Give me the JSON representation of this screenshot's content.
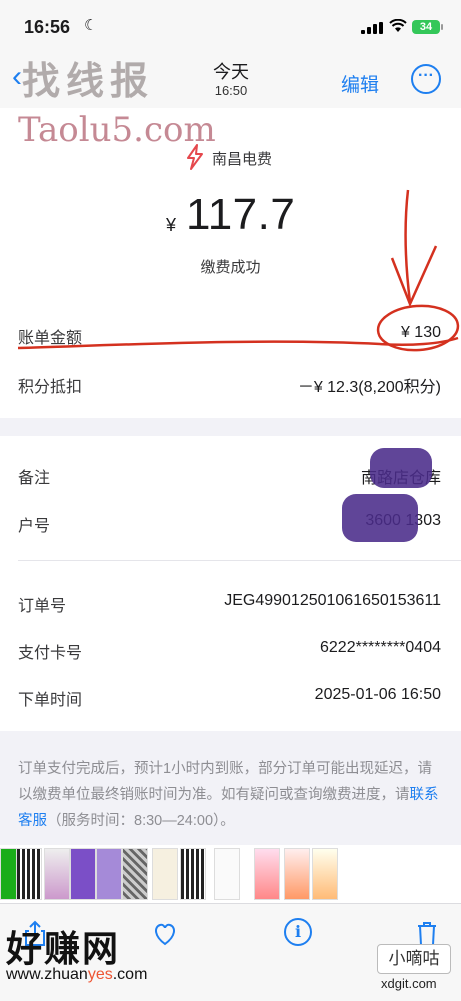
{
  "status_bar": {
    "time": "16:56",
    "battery": "34"
  },
  "nav": {
    "title": "今天",
    "subtitle": "16:50",
    "edit_label": "编辑",
    "more_label": "···"
  },
  "header": {
    "merchant": "南昌电费",
    "currency": "¥",
    "amount": "117.7",
    "status": "缴费成功"
  },
  "summary": [
    {
      "label": "账单金额",
      "value": "¥ 130"
    },
    {
      "label": "积分抵扣",
      "value": "－¥ 12.3(8,200积分)"
    }
  ],
  "details": [
    {
      "label": "备注",
      "value": "南路店仓库"
    },
    {
      "label": "户号",
      "value": "3600 1303"
    }
  ],
  "order": [
    {
      "label": "订单号",
      "value": "JEG4990125010616501536​11"
    },
    {
      "label": "支付卡号",
      "value": "6222********0404"
    },
    {
      "label": "下单时间",
      "value": "2025-01-06 16:50"
    }
  ],
  "note": {
    "text": "订单支付完成后，预计1小时内到账，部分订单可能出现延迟，请以缴费单位最终销账时间为准。如有疑问或查询缴费进度，请",
    "link": "联系客服",
    "tail": "（服务时间：8:30—24:00）。"
  },
  "watermarks": {
    "top": "找线报",
    "top_url": "Taolu5.com",
    "bottom": "好赚网",
    "bottom_url_a": "www.zhuan",
    "bottom_url_b": "yes",
    "bottom_url_c": ".com",
    "right": "小嘀咕",
    "right_url": "xdgit.com"
  },
  "icons": {
    "back": "chevron-left-icon",
    "more": "ellipsis-circle-icon",
    "merchant": "lightning-bolt-icon",
    "share": "share-icon",
    "favorite": "heart-icon",
    "info": "info-icon",
    "delete": "trash-icon"
  },
  "colors": {
    "accent": "#1e7ff0",
    "annotation": "#d4311f",
    "redaction": "#4a2b8a"
  }
}
